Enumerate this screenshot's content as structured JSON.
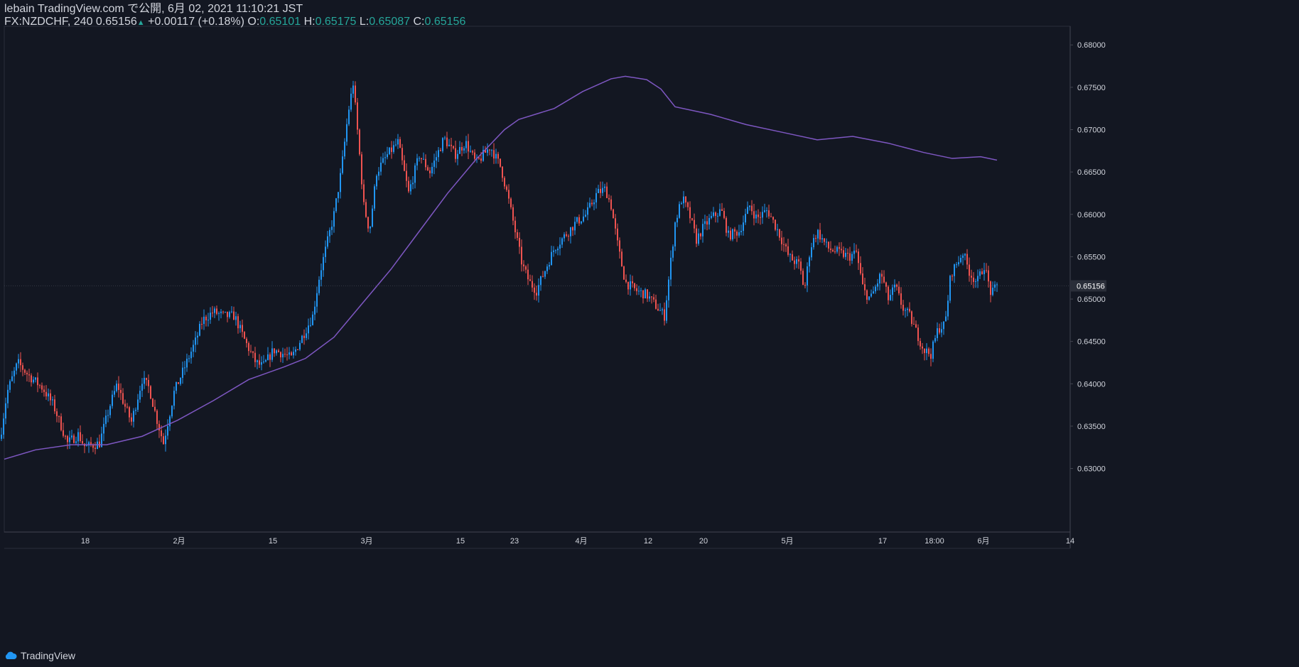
{
  "header": {
    "published": "lebain TradingView.com で公開, 6月 02, 2021 11:10:21 JST",
    "symbol": "FX:NZDCHF, 240",
    "last": "0.65156",
    "change": "+0.00117 (+0.18%)",
    "o_label": "O:",
    "o": "0.65101",
    "h_label": "H:",
    "h": "0.65175",
    "l_label": "L:",
    "l": "0.65087",
    "c_label": "C:",
    "c": "0.65156"
  },
  "footer": {
    "brand": "TradingView"
  },
  "colors": {
    "background": "#131722",
    "up": "#2196f3",
    "down": "#ef5350",
    "ma": "#7e57c2",
    "axis_text": "#d1d4dc",
    "change": "#26a69a"
  },
  "chart_data": {
    "type": "candlestick",
    "symbol": "FX:NZDCHF",
    "interval": "240",
    "ylim": [
      0.6225,
      0.6822
    ],
    "y_ticks": [
      0.63,
      0.635,
      0.64,
      0.645,
      0.65,
      0.655,
      0.66,
      0.665,
      0.67,
      0.675,
      0.68
    ],
    "x_ticks": [
      "18",
      "2月",
      "15",
      "3月",
      "15",
      "23",
      "4月",
      "12",
      "20",
      "5月",
      "17",
      "18:00",
      "6月",
      "14"
    ],
    "last_price": 0.65156,
    "price_anchors": [
      [
        0,
        0.6335
      ],
      [
        10,
        0.639
      ],
      [
        25,
        0.6425
      ],
      [
        40,
        0.641
      ],
      [
        60,
        0.6395
      ],
      [
        75,
        0.6375
      ],
      [
        95,
        0.633
      ],
      [
        110,
        0.634
      ],
      [
        120,
        0.6325
      ],
      [
        140,
        0.633
      ],
      [
        155,
        0.6375
      ],
      [
        165,
        0.64
      ],
      [
        175,
        0.6375
      ],
      [
        185,
        0.6355
      ],
      [
        200,
        0.6405
      ],
      [
        210,
        0.6395
      ],
      [
        220,
        0.636
      ],
      [
        230,
        0.633
      ],
      [
        245,
        0.639
      ],
      [
        260,
        0.642
      ],
      [
        275,
        0.645
      ],
      [
        285,
        0.6475
      ],
      [
        300,
        0.6485
      ],
      [
        315,
        0.648
      ],
      [
        330,
        0.648
      ],
      [
        345,
        0.645
      ],
      [
        360,
        0.6425
      ],
      [
        370,
        0.642
      ],
      [
        385,
        0.644
      ],
      [
        400,
        0.6435
      ],
      [
        410,
        0.643
      ],
      [
        425,
        0.6455
      ],
      [
        440,
        0.648
      ],
      [
        450,
        0.653
      ],
      [
        460,
        0.6565
      ],
      [
        470,
        0.66
      ],
      [
        480,
        0.665
      ],
      [
        490,
        0.672
      ],
      [
        497,
        0.6755
      ],
      [
        505,
        0.668
      ],
      [
        512,
        0.661
      ],
      [
        520,
        0.658
      ],
      [
        530,
        0.665
      ],
      [
        545,
        0.667
      ],
      [
        560,
        0.6685
      ],
      [
        575,
        0.6625
      ],
      [
        590,
        0.667
      ],
      [
        605,
        0.665
      ],
      [
        625,
        0.669
      ],
      [
        640,
        0.667
      ],
      [
        655,
        0.6685
      ],
      [
        670,
        0.666
      ],
      [
        690,
        0.668
      ],
      [
        705,
        0.6655
      ],
      [
        715,
        0.662
      ],
      [
        725,
        0.658
      ],
      [
        735,
        0.654
      ],
      [
        745,
        0.652
      ],
      [
        755,
        0.651
      ],
      [
        765,
        0.653
      ],
      [
        780,
        0.656
      ],
      [
        795,
        0.6575
      ],
      [
        810,
        0.659
      ],
      [
        825,
        0.66
      ],
      [
        840,
        0.6625
      ],
      [
        852,
        0.663
      ],
      [
        860,
        0.661
      ],
      [
        870,
        0.656
      ],
      [
        880,
        0.652
      ],
      [
        895,
        0.651
      ],
      [
        910,
        0.6505
      ],
      [
        925,
        0.649
      ],
      [
        935,
        0.648
      ],
      [
        942,
        0.653
      ],
      [
        950,
        0.659
      ],
      [
        960,
        0.662
      ],
      [
        970,
        0.66
      ],
      [
        980,
        0.657
      ],
      [
        990,
        0.6585
      ],
      [
        1000,
        0.6595
      ],
      [
        1015,
        0.6605
      ],
      [
        1025,
        0.6575
      ],
      [
        1040,
        0.658
      ],
      [
        1055,
        0.661
      ],
      [
        1065,
        0.6595
      ],
      [
        1080,
        0.6605
      ],
      [
        1095,
        0.658
      ],
      [
        1110,
        0.655
      ],
      [
        1125,
        0.654
      ],
      [
        1132,
        0.651
      ],
      [
        1140,
        0.656
      ],
      [
        1150,
        0.658
      ],
      [
        1165,
        0.656
      ],
      [
        1180,
        0.6555
      ],
      [
        1195,
        0.655
      ],
      [
        1205,
        0.6555
      ],
      [
        1215,
        0.651
      ],
      [
        1225,
        0.65
      ],
      [
        1240,
        0.653
      ],
      [
        1250,
        0.65
      ],
      [
        1260,
        0.6515
      ],
      [
        1270,
        0.649
      ],
      [
        1280,
        0.648
      ],
      [
        1290,
        0.646
      ],
      [
        1300,
        0.644
      ],
      [
        1310,
        0.6435
      ],
      [
        1320,
        0.6465
      ],
      [
        1330,
        0.647
      ],
      [
        1338,
        0.653
      ],
      [
        1345,
        0.654
      ],
      [
        1355,
        0.6555
      ],
      [
        1365,
        0.653
      ],
      [
        1375,
        0.652
      ],
      [
        1385,
        0.654
      ],
      [
        1395,
        0.6505
      ],
      [
        1403,
        0.65156
      ]
    ],
    "ma_anchors": [
      [
        6,
        0.6311
      ],
      [
        50,
        0.6322
      ],
      [
        100,
        0.6328
      ],
      [
        150,
        0.6328
      ],
      [
        200,
        0.6338
      ],
      [
        250,
        0.6357
      ],
      [
        300,
        0.638
      ],
      [
        350,
        0.6405
      ],
      [
        400,
        0.642
      ],
      [
        430,
        0.643
      ],
      [
        470,
        0.6455
      ],
      [
        510,
        0.6495
      ],
      [
        550,
        0.6535
      ],
      [
        590,
        0.658
      ],
      [
        630,
        0.6625
      ],
      [
        670,
        0.6665
      ],
      [
        710,
        0.67
      ],
      [
        730,
        0.6712
      ],
      [
        780,
        0.6725
      ],
      [
        820,
        0.6745
      ],
      [
        860,
        0.676
      ],
      [
        880,
        0.6763
      ],
      [
        910,
        0.6759
      ],
      [
        930,
        0.6748
      ],
      [
        950,
        0.6727
      ],
      [
        1000,
        0.6718
      ],
      [
        1050,
        0.6706
      ],
      [
        1100,
        0.6697
      ],
      [
        1150,
        0.6688
      ],
      [
        1200,
        0.6692
      ],
      [
        1250,
        0.6684
      ],
      [
        1300,
        0.6673
      ],
      [
        1340,
        0.6666
      ],
      [
        1380,
        0.6668
      ],
      [
        1403,
        0.6664
      ]
    ]
  }
}
